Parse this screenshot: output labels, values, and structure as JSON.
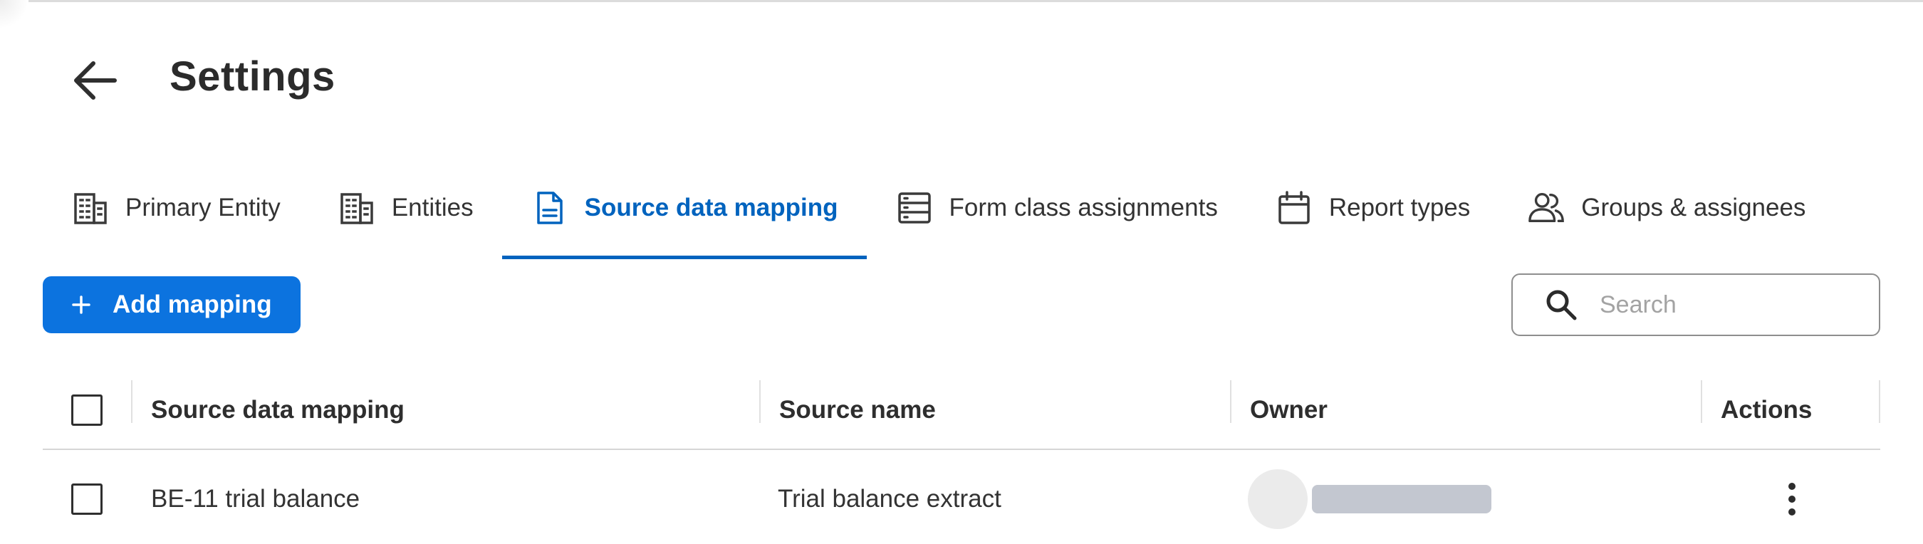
{
  "header": {
    "title": "Settings",
    "back_icon": "arrow-left-icon"
  },
  "tabs": [
    {
      "label": "Primary Entity",
      "icon": "building-icon",
      "active": false
    },
    {
      "label": "Entities",
      "icon": "building-icon",
      "active": false
    },
    {
      "label": "Source data mapping",
      "icon": "document-icon",
      "active": true
    },
    {
      "label": "Form class assignments",
      "icon": "list-table-icon",
      "active": false
    },
    {
      "label": "Report types",
      "icon": "calendar-icon",
      "active": false
    },
    {
      "label": "Groups & assignees",
      "icon": "users-icon",
      "active": false
    }
  ],
  "toolbar": {
    "add_label": "Add mapping",
    "search_placeholder": "Search",
    "search_value": ""
  },
  "table": {
    "columns": [
      "Source data mapping",
      "Source name",
      "Owner",
      "Actions"
    ],
    "rows": [
      {
        "mapping": "BE-11 trial balance",
        "source_name": "Trial balance extract",
        "owner": ""
      }
    ]
  },
  "colors": {
    "accent": "#0063be",
    "primary_button": "#0c73df",
    "text": "#2c2c2c",
    "placeholder_bar": "#c3c7d0"
  }
}
